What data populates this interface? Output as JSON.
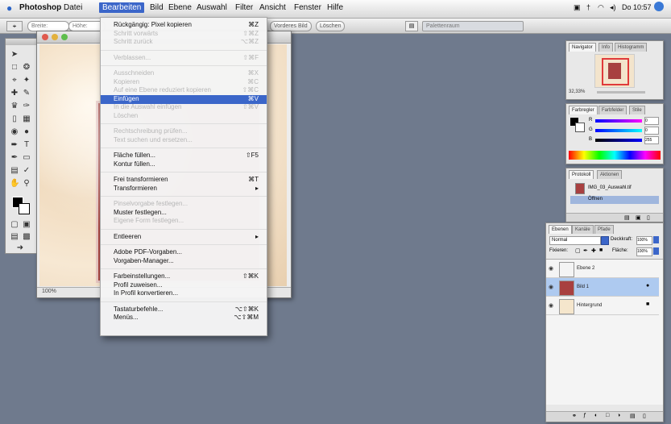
{
  "menubar": {
    "items": [
      "Photoshop",
      "Datei",
      "Bearbeiten",
      "Bild",
      "Ebene",
      "Auswahl",
      "Filter",
      "Ansicht",
      "Fenster",
      "Hilfe"
    ],
    "active": "Bearbeiten",
    "clock": "Do 10:57"
  },
  "options_bar": {
    "field1": "Breite:",
    "field2": "Höhe:",
    "btn1": "Vorderes Bild",
    "btn2": "Löschen",
    "panel_field": "Palettenraum"
  },
  "doc": {
    "status_zoom": "100%"
  },
  "edit_menu": {
    "items": [
      {
        "label": "Rückgängig: Pixel kopieren",
        "shortcut": "⌘Z",
        "state": "en"
      },
      {
        "label": "Schritt vorwärts",
        "shortcut": "⇧⌘Z",
        "state": "dis"
      },
      {
        "label": "Schritt zurück",
        "shortcut": "⌥⌘Z",
        "state": "dis"
      },
      {
        "sep": true
      },
      {
        "label": "Verblassen...",
        "shortcut": "⇧⌘F",
        "state": "dis"
      },
      {
        "sep": true
      },
      {
        "label": "Ausschneiden",
        "shortcut": "⌘X",
        "state": "dis"
      },
      {
        "label": "Kopieren",
        "shortcut": "⌘C",
        "state": "dis"
      },
      {
        "label": "Auf eine Ebene reduziert kopieren",
        "shortcut": "⇧⌘C",
        "state": "dis"
      },
      {
        "label": "Einfügen",
        "shortcut": "⌘V",
        "state": "hl"
      },
      {
        "label": "In die Auswahl einfügen",
        "shortcut": "⇧⌘V",
        "state": "dis"
      },
      {
        "label": "Löschen",
        "shortcut": "",
        "state": "dis"
      },
      {
        "sep": true
      },
      {
        "label": "Rechtschreibung prüfen...",
        "shortcut": "",
        "state": "dis"
      },
      {
        "label": "Text suchen und ersetzen...",
        "shortcut": "",
        "state": "dis"
      },
      {
        "sep": true
      },
      {
        "label": "Fläche füllen...",
        "shortcut": "⇧F5",
        "state": "en"
      },
      {
        "label": "Kontur füllen...",
        "shortcut": "",
        "state": "en"
      },
      {
        "sep": true
      },
      {
        "label": "Frei transformieren",
        "shortcut": "⌘T",
        "state": "en"
      },
      {
        "label": "Transformieren",
        "shortcut": "▸",
        "state": "en"
      },
      {
        "sep": true
      },
      {
        "label": "Pinselvorgabe festlegen...",
        "shortcut": "",
        "state": "dis"
      },
      {
        "label": "Muster festlegen...",
        "shortcut": "",
        "state": "en"
      },
      {
        "label": "Eigene Form festlegen...",
        "shortcut": "",
        "state": "dis"
      },
      {
        "sep": true
      },
      {
        "label": "Entleeren",
        "shortcut": "▸",
        "state": "en"
      },
      {
        "sep": true
      },
      {
        "label": "Adobe PDF-Vorgaben...",
        "shortcut": "",
        "state": "en"
      },
      {
        "label": "Vorgaben-Manager...",
        "shortcut": "",
        "state": "en"
      },
      {
        "sep": true
      },
      {
        "label": "Farbeinstellungen...",
        "shortcut": "⇧⌘K",
        "state": "en"
      },
      {
        "label": "Profil zuweisen...",
        "shortcut": "",
        "state": "en"
      },
      {
        "label": "In Profil konvertieren...",
        "shortcut": "",
        "state": "en"
      },
      {
        "sep": true
      },
      {
        "label": "Tastaturbefehle...",
        "shortcut": "⌥⇧⌘K",
        "state": "en"
      },
      {
        "label": "Menüs...",
        "shortcut": "⌥⇧⌘M",
        "state": "en"
      }
    ]
  },
  "navigator": {
    "tabs": [
      "Navigator",
      "Info",
      "Histogramm"
    ],
    "zoom": "32,33%"
  },
  "color_panel": {
    "tabs": [
      "Farbregler",
      "Farbfelder",
      "Stile"
    ],
    "channels": [
      "R",
      "G",
      "B"
    ],
    "values": [
      "0",
      "0",
      "255"
    ]
  },
  "paths_panel": {
    "tabs": [
      "Protokoll",
      "Aktionen"
    ],
    "items": [
      "IMG_03_Auswahl.tif",
      "Öffnen"
    ]
  },
  "layers_panel": {
    "tabs": [
      "Ebenen",
      "Kanäle",
      "Pfade"
    ],
    "blend": "Normal",
    "opacity_label": "Deckkraft:",
    "opacity": "100%",
    "lock_label": "Fixieren:",
    "fill_label": "Fläche:",
    "fill": "100%",
    "layers": [
      {
        "name": "Ebene 2",
        "selected": false,
        "thumb": "#f4f4f4"
      },
      {
        "name": "Bild 1",
        "selected": true,
        "thumb": "#a84040"
      },
      {
        "name": "Hintergrund",
        "selected": false,
        "thumb": "#f5e6cc"
      }
    ]
  }
}
